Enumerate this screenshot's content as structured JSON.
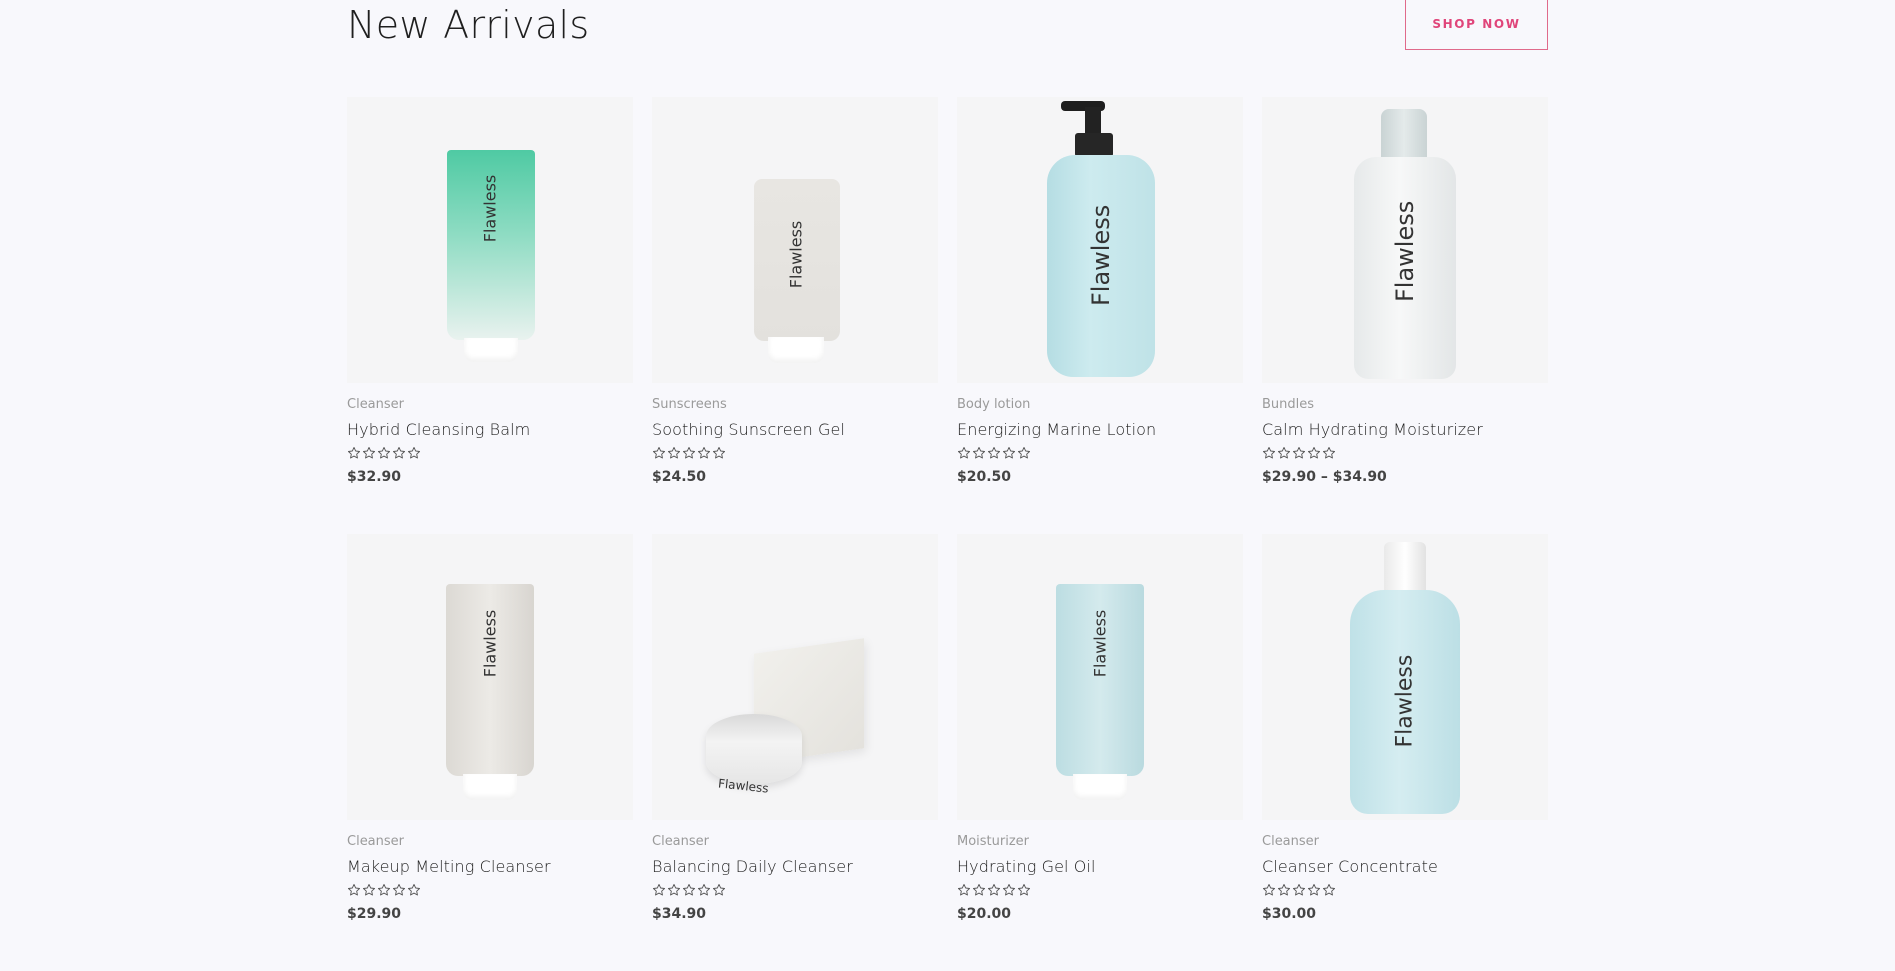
{
  "section": {
    "title": "New Arrivals",
    "shop_button": "SHOP NOW"
  },
  "brand": "Flawless",
  "colors": {
    "accent": "#e0457a",
    "background": "#f8f8fc",
    "card_bg": "#f5f5f6",
    "star_outline": "#555555"
  },
  "products": [
    {
      "category": "Cleanser",
      "name": "Hybrid Cleansing Balm",
      "price": "$32.90",
      "rating": 0
    },
    {
      "category": "Sunscreens",
      "name": "Soothing Sunscreen Gel",
      "price": "$24.50",
      "rating": 0
    },
    {
      "category": "Body lotion",
      "name": "Energizing Marine Lotion",
      "price": "$20.50",
      "rating": 0
    },
    {
      "category": "Bundles",
      "name": "Calm Hydrating Moisturizer",
      "price": "$29.90 – $34.90",
      "rating": 0
    },
    {
      "category": "Cleanser",
      "name": "Makeup Melting Cleanser",
      "price": "$29.90",
      "rating": 0
    },
    {
      "category": "Cleanser",
      "name": "Balancing Daily Cleanser",
      "price": "$34.90",
      "rating": 0
    },
    {
      "category": "Moisturizer",
      "name": "Hydrating Gel Oil",
      "price": "$20.00",
      "rating": 0
    },
    {
      "category": "Cleanser",
      "name": "Cleanser Concentrate",
      "price": "$30.00",
      "rating": 0
    }
  ]
}
